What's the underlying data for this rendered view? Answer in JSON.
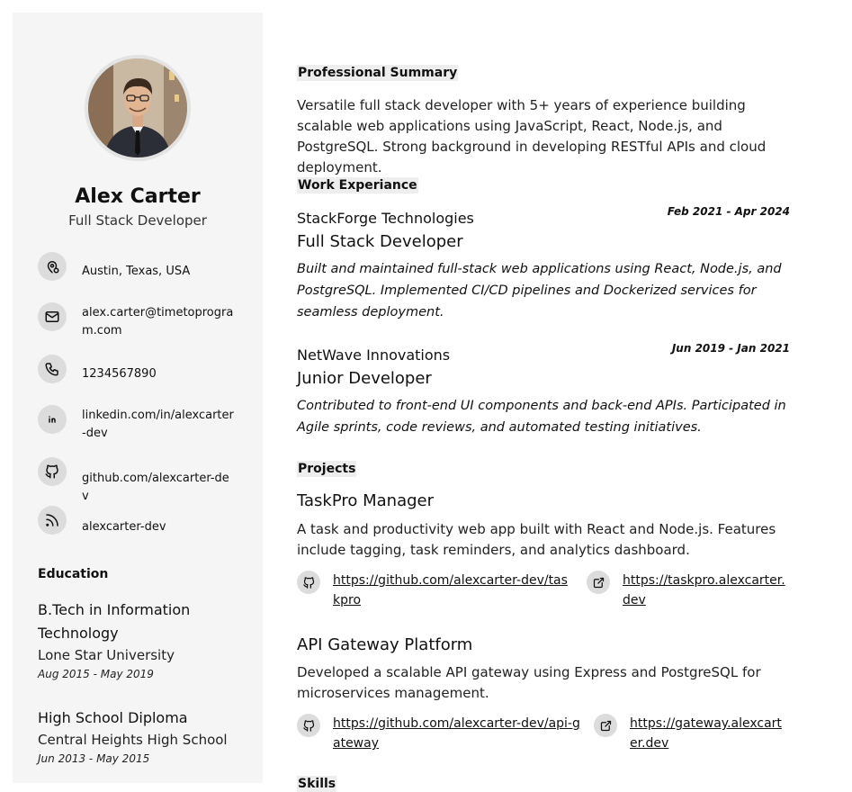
{
  "profile": {
    "name": "Alex Carter",
    "title": "Full Stack Developer"
  },
  "contact": {
    "location": "Austin, Texas, USA",
    "email": "alex.carter@timetoprogram.com",
    "phone": "1234567890",
    "linkedin": "linkedin.com/in/alexcarter-dev",
    "github": "github.com/alexcarter-dev",
    "website": "alexcarter-dev"
  },
  "education": {
    "heading": "Education",
    "items": [
      {
        "degree": "B.Tech in Information Technology",
        "school": "Lone Star University",
        "dates": "Aug 2015 - May 2019"
      },
      {
        "degree": "High School Diploma",
        "school": "Central Heights High School",
        "dates": "Jun 2013 - May 2015"
      }
    ]
  },
  "summary": {
    "heading": "Professional Summary",
    "text": "Versatile full stack developer with 5+ years of experience building scalable web applications using JavaScript, React, Node.js, and PostgreSQL. Strong background in developing RESTful APIs and cloud deployment."
  },
  "work": {
    "heading": "Work Experiance",
    "items": [
      {
        "company": "StackForge Technologies",
        "dates": "Feb 2021 - Apr 2024",
        "role": "Full Stack Developer",
        "description": "Built and maintained full-stack web applications using React, Node.js, and PostgreSQL. Implemented CI/CD pipelines and Dockerized services for seamless deployment."
      },
      {
        "company": "NetWave Innovations",
        "dates": "Jun 2019 - Jan 2021",
        "role": "Junior Developer",
        "description": "Contributed to front-end UI components and back-end APIs. Participated in Agile sprints, code reviews, and automated testing initiatives."
      }
    ]
  },
  "projects": {
    "heading": "Projects",
    "items": [
      {
        "title": "TaskPro Manager",
        "description": "A task and productivity web app built with React and Node.js. Features include tagging, task reminders, and analytics dashboard.",
        "github_link": "https://github.com/alexcarter-dev/taskpro",
        "live_link": "https://taskpro.alexcarter.dev"
      },
      {
        "title": "API Gateway Platform",
        "description": "Developed a scalable API gateway using Express and PostgreSQL for microservices management.",
        "github_link": "https://github.com/alexcarter-dev/api-gateway",
        "live_link": "https://gateway.alexcarter.dev"
      }
    ]
  },
  "skills": {
    "heading": "Skills"
  },
  "icons": {
    "location": "location-pin-icon",
    "email": "mail-icon",
    "phone": "phone-icon",
    "linkedin": "linkedin-icon",
    "github": "github-icon",
    "rss": "rss-icon",
    "external": "external-link-icon"
  }
}
